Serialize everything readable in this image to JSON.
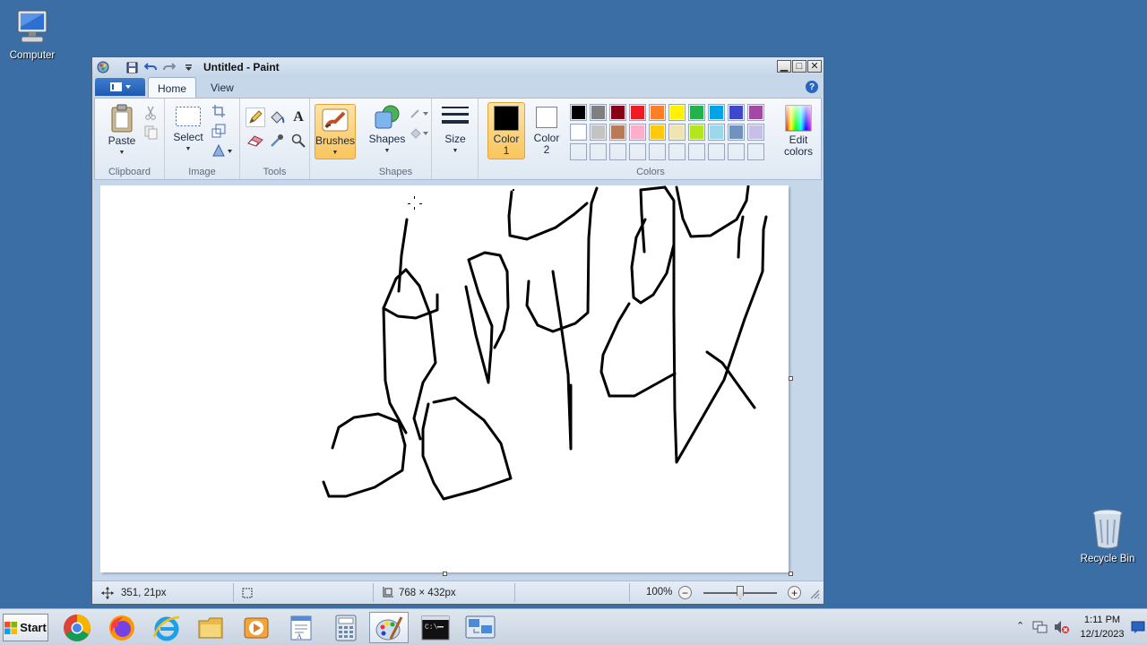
{
  "desktop": {
    "icons": [
      {
        "label": "Computer"
      },
      {
        "label": "Recycle Bin"
      }
    ],
    "background_color": "#3b6ea5"
  },
  "window": {
    "title": "Untitled - Paint",
    "minimize_glyph": "▁",
    "maximize_glyph": "□",
    "close_glyph": "✕"
  },
  "ribbon": {
    "tabs": [
      {
        "label": "Home",
        "active": true
      },
      {
        "label": "View",
        "active": false
      }
    ],
    "help_glyph": "?",
    "groups": {
      "clipboard": {
        "label": "Clipboard",
        "paste": "Paste"
      },
      "image": {
        "label": "Image",
        "select": "Select"
      },
      "tools": {
        "label": "Tools"
      },
      "brushes": {
        "label": "Brushes"
      },
      "shapes": {
        "label": "Shapes",
        "shapes_button": "Shapes"
      },
      "size": {
        "label": "Size"
      },
      "colors": {
        "label": "Colors",
        "color1_line1": "Color",
        "color1_line2": "1",
        "color2_line1": "Color",
        "color2_line2": "2",
        "color1_value": "#000000",
        "color2_value": "#ffffff",
        "edit_line1": "Edit",
        "edit_line2": "colors",
        "palette_row1": [
          "#000000",
          "#7f7f7f",
          "#880015",
          "#ed1c24",
          "#ff7f27",
          "#fff200",
          "#22b14c",
          "#00a2e8",
          "#3f48cc",
          "#a349a4"
        ],
        "palette_row2": [
          "#ffffff",
          "#c3c3c3",
          "#b97a57",
          "#ffaec9",
          "#ffc90e",
          "#efe4b0",
          "#b5e61d",
          "#99d9ea",
          "#7092be",
          "#c8bfe7"
        ],
        "palette_row3": [
          "",
          "",
          "",
          "",
          "",
          "",
          "",
          "",
          "",
          ""
        ]
      }
    }
  },
  "status": {
    "cursor_position": "351, 21px",
    "selection_size": "",
    "canvas_size": "768 × 432px",
    "zoom": "100%",
    "zoom_minus": "−",
    "zoom_plus": "+"
  },
  "taskbar": {
    "start_label": "Start",
    "apps": [
      "chrome-icon",
      "firefox-icon",
      "internet-explorer-icon",
      "file-explorer-icon",
      "media-player-icon",
      "wordpad-icon",
      "calculator-icon",
      "paint-icon",
      "command-prompt-icon",
      "remote-desktop-icon"
    ],
    "active_app": "paint-icon",
    "tray_arrow": "⌃",
    "time": "1:11 PM",
    "date": "12/1/2023"
  }
}
